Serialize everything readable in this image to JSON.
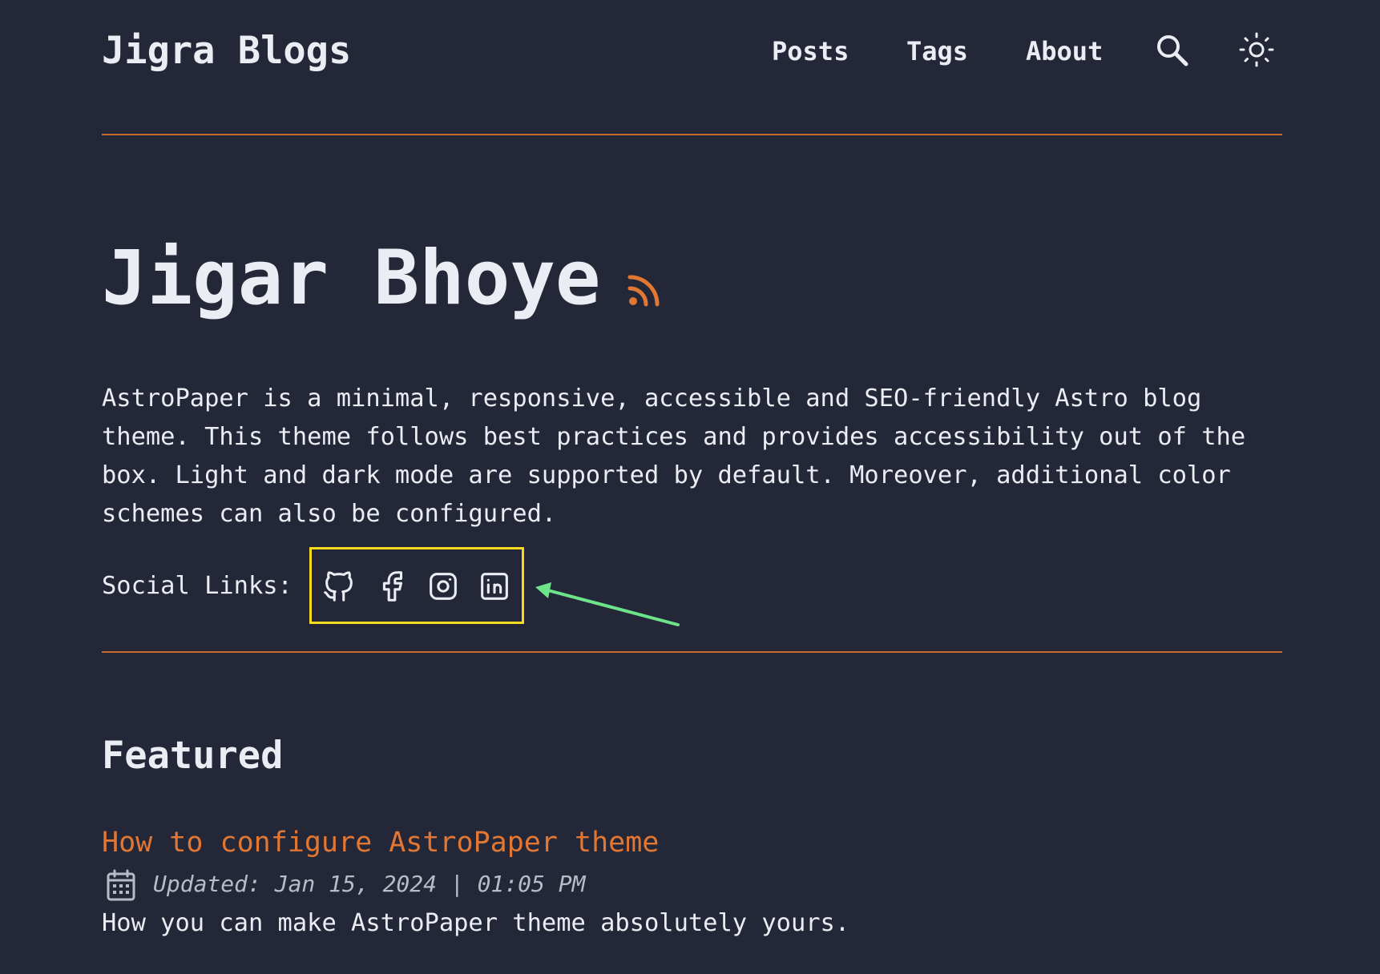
{
  "header": {
    "site_title": "Jigra Blogs",
    "nav": [
      {
        "label": "Posts"
      },
      {
        "label": "Tags"
      },
      {
        "label": "About"
      }
    ],
    "search_icon": "search-icon",
    "theme_icon": "sun-icon"
  },
  "hero": {
    "title": "Jigar Bhoye",
    "rss_icon": "rss-icon",
    "intro": "AstroPaper is a minimal, responsive, accessible and SEO-friendly Astro blog theme. This theme follows best practices and provides accessibility out of the box. Light and dark mode are supported by default. Moreover, additional color schemes can also be configured.",
    "social_label": "Social Links:",
    "social_icons": [
      "github-icon",
      "facebook-icon",
      "instagram-icon",
      "linkedin-icon"
    ]
  },
  "featured": {
    "heading": "Featured",
    "posts": [
      {
        "title": "How to configure AstroPaper theme",
        "date": "Updated: Jan 15, 2024 | 01:05 PM",
        "description": "How you can make AstroPaper theme absolutely yours."
      }
    ]
  },
  "colors": {
    "background": "#232737",
    "text": "#eaedf3",
    "accent": "#e17733",
    "divider": "#c76a2d",
    "highlight_box": "#f7dc1e",
    "annotation_arrow": "#6de38a"
  }
}
